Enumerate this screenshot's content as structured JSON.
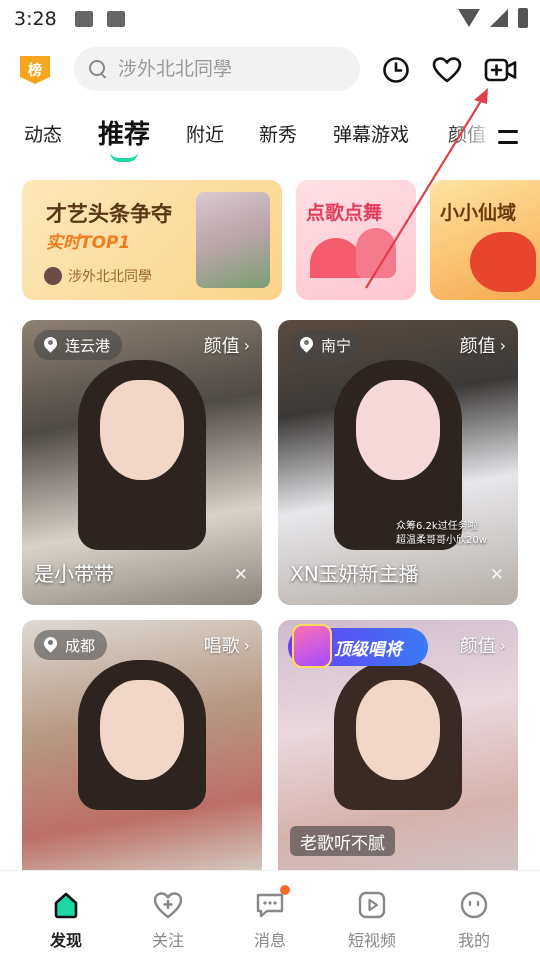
{
  "status_bar": {
    "time": "3:28"
  },
  "header": {
    "rank_badge": "榜",
    "search": {
      "placeholder": "涉外北北同學",
      "value": ""
    },
    "icons": [
      "history-icon",
      "heart-icon",
      "start-live-icon"
    ]
  },
  "tabs": {
    "items": [
      {
        "label": "动态"
      },
      {
        "label": "推荐",
        "active": true
      },
      {
        "label": "附近"
      },
      {
        "label": "新秀"
      },
      {
        "label": "弹幕游戏"
      },
      {
        "label": "颜值"
      }
    ]
  },
  "banners": {
    "main": {
      "title": "才艺头条争夺",
      "subtitle": "实时TOP1",
      "user": "涉外北北同學"
    },
    "song": {
      "title": "点歌点舞"
    },
    "game": {
      "title": "小小仙域"
    }
  },
  "cards": [
    {
      "location": "连云港",
      "category": "颜值",
      "name": "是小带带"
    },
    {
      "location": "南宁",
      "category": "颜值",
      "name": "XN玉妍新主播",
      "overlay_text": "众筹6.2k过任务啦\n超温柔哥哥小欣20w"
    },
    {
      "location": "成都",
      "category": "唱歌",
      "name": ""
    },
    {
      "badge": "顶级唱将",
      "category": "颜值",
      "song_tag": "老歌听不腻",
      "name": ""
    }
  ],
  "bottom_nav": {
    "items": [
      {
        "label": "发现",
        "active": true,
        "icon": "discover-icon"
      },
      {
        "label": "关注",
        "icon": "follow-heart-icon"
      },
      {
        "label": "消息",
        "icon": "message-icon",
        "badge_dot": true
      },
      {
        "label": "短视频",
        "icon": "short-video-icon"
      },
      {
        "label": "我的",
        "icon": "profile-icon"
      }
    ]
  },
  "colors": {
    "accent": "#1dd8a4",
    "rank_badge": "#f7a51f",
    "annotation_arrow": "#e0404a",
    "notification_dot": "#ff6a2a"
  }
}
